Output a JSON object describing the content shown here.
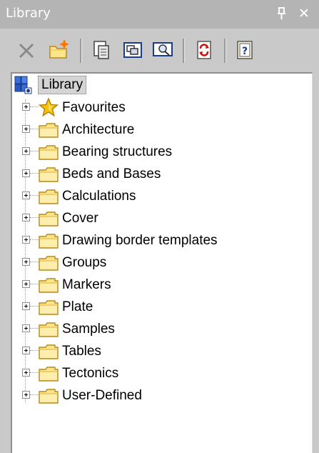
{
  "window": {
    "title": "Library",
    "pin_glyph": "ᵖ",
    "close_glyph": "✕"
  },
  "toolbar": {
    "items": [
      "delete-icon",
      "new-folder-icon",
      "properties-icon",
      "insert-icon",
      "preview-icon",
      "refresh-icon",
      "help-icon"
    ]
  },
  "tree": {
    "root_label": "Library",
    "items": [
      {
        "label": "Favourites",
        "icon": "star-icon"
      },
      {
        "label": "Architecture",
        "icon": "folder-icon"
      },
      {
        "label": "Bearing structures",
        "icon": "folder-icon"
      },
      {
        "label": "Beds and Bases",
        "icon": "folder-icon"
      },
      {
        "label": "Calculations",
        "icon": "folder-icon"
      },
      {
        "label": "Cover",
        "icon": "folder-icon"
      },
      {
        "label": "Drawing border templates",
        "icon": "folder-icon"
      },
      {
        "label": "Groups",
        "icon": "folder-icon"
      },
      {
        "label": "Markers",
        "icon": "folder-icon"
      },
      {
        "label": "Plate",
        "icon": "folder-icon"
      },
      {
        "label": "Samples",
        "icon": "folder-icon"
      },
      {
        "label": "Tables",
        "icon": "folder-icon"
      },
      {
        "label": "Tectonics",
        "icon": "folder-icon"
      },
      {
        "label": "User-Defined",
        "icon": "folder-icon"
      }
    ]
  },
  "colors": {
    "panel_bg": "#c9c9c9",
    "titlebar_bg": "#b4b4b4",
    "folder_fill": "#fde58a",
    "folder_stroke": "#b88a1a",
    "star_fill": "#f5c200"
  }
}
